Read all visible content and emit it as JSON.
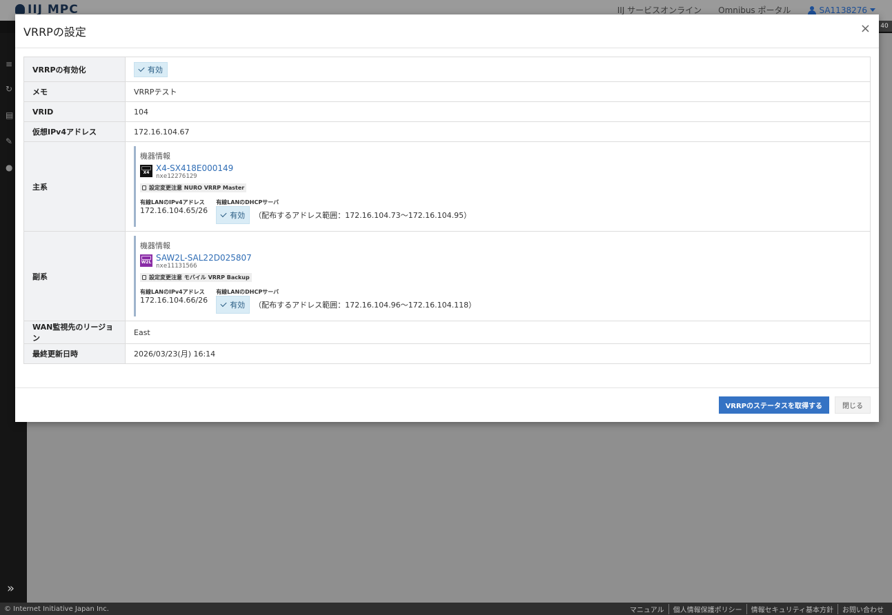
{
  "app": {
    "logo": "IIJ MPC",
    "header_links": [
      "IIJ サービスオンライン",
      "Omnibus ポータル"
    ],
    "user": "SA1138276",
    "subbar_badge": "40"
  },
  "footer": {
    "copyright": "© Internet Initiative Japan Inc.",
    "links": [
      "マニュアル",
      "個人情報保護ポリシー",
      "情報セキュリティ基本方針",
      "お問い合わせ"
    ]
  },
  "modal": {
    "title": "VRRPの設定",
    "close": "×",
    "rows": {
      "enabled": {
        "label": "VRRPの有効化",
        "value": "有効"
      },
      "memo": {
        "label": "メモ",
        "value": "VRRPテスト"
      },
      "vrid": {
        "label": "VRID",
        "value": "104"
      },
      "vip": {
        "label": "仮想IPv4アドレス",
        "value": "172.16.104.67"
      },
      "primary": {
        "label": "主系",
        "heading": "機器情報",
        "device_icon": "X4",
        "device_name": "X4-SX418E000149",
        "device_id": "nxe12276129",
        "note": "設定変更注意 NURO VRRP Master",
        "ip_label": "有線LANのIPv4アドレス",
        "ip_value": "172.16.104.65/26",
        "dhcp_label": "有線LANのDHCPサーバ",
        "dhcp_status": "有効",
        "dhcp_range": "（配布するアドレス範囲：172.16.104.73〜172.16.104.95）"
      },
      "secondary": {
        "label": "副系",
        "heading": "機器情報",
        "device_icon": "W2L",
        "device_name": "SAW2L-SAL22D025807",
        "device_id": "nxe11131566",
        "note": "設定変更注意 モバイル VRRP Backup",
        "ip_label": "有線LANのIPv4アドレス",
        "ip_value": "172.16.104.66/26",
        "dhcp_label": "有線LANのDHCPサーバ",
        "dhcp_status": "有効",
        "dhcp_range": "（配布するアドレス範囲：172.16.104.96〜172.16.104.118）"
      },
      "wan_region": {
        "label": "WAN監視先のリージョン",
        "value": "East"
      },
      "updated": {
        "label": "最終更新日時",
        "value": "2026/03/23(月) 16:14"
      }
    },
    "buttons": {
      "status": "VRRPのステータスを取得する",
      "close": "閉じる"
    }
  }
}
